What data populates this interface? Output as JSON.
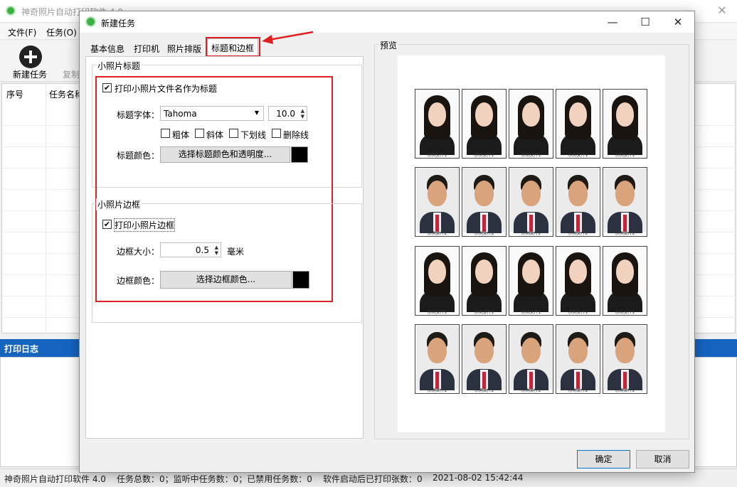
{
  "main_window": {
    "title": "神奇照片自动打印软件 4.0",
    "menu": [
      "文件(F)",
      "任务(O)"
    ],
    "toolbar": {
      "new_task": "新建任务",
      "copy": "复制"
    },
    "list_columns": [
      "序号",
      "任务名称"
    ],
    "log_title": "打印日志"
  },
  "status_bar": {
    "app": "神奇照片自动打印软件 4.0",
    "stats": "任务总数：0；监听中任务数：0；已禁用任务数：0",
    "printed": "软件启动后已打印张数：0",
    "datetime": "2021-08-02 15:42:44"
  },
  "dialog": {
    "title": "新建任务",
    "tabs": [
      "基本信息",
      "打印机",
      "照片排版",
      "标题和边框"
    ],
    "active_tab": 3,
    "title_group": {
      "label": "小照片标题",
      "print_filename_checkbox": "打印小照片文件名作为标题",
      "print_filename_checked": true,
      "font_label": "标题字体：",
      "font_value": "Tahoma",
      "font_size": "10.0",
      "bold": "粗体",
      "italic": "斜体",
      "underline": "下划线",
      "strikeout": "删除线",
      "color_label": "标题颜色：",
      "color_button": "选择标题颜色和透明度...",
      "color_value": "#000000"
    },
    "border_group": {
      "label": "小照片边框",
      "print_border_checkbox": "打印小照片边框",
      "print_border_checked": true,
      "size_label": "边框大小：",
      "size_value": "0.5",
      "size_unit": "毫米",
      "color_label": "边框颜色：",
      "color_button": "选择边框颜色...",
      "color_value": "#000000"
    },
    "preview": {
      "label": "预览",
      "caption_female": "示例文件1",
      "caption_male": "示例文件2"
    },
    "ok": "确定",
    "cancel": "取消"
  },
  "colors": {
    "highlight_red": "#e02020",
    "log_header_blue": "#1565c0",
    "app_icon_green": "#3cb043"
  },
  "icons": [
    "app-icon",
    "plus-icon",
    "minimize-icon",
    "maximize-icon",
    "close-icon",
    "dropdown-arrow-icon",
    "spin-arrow-icon",
    "red-arrow-icon"
  ]
}
